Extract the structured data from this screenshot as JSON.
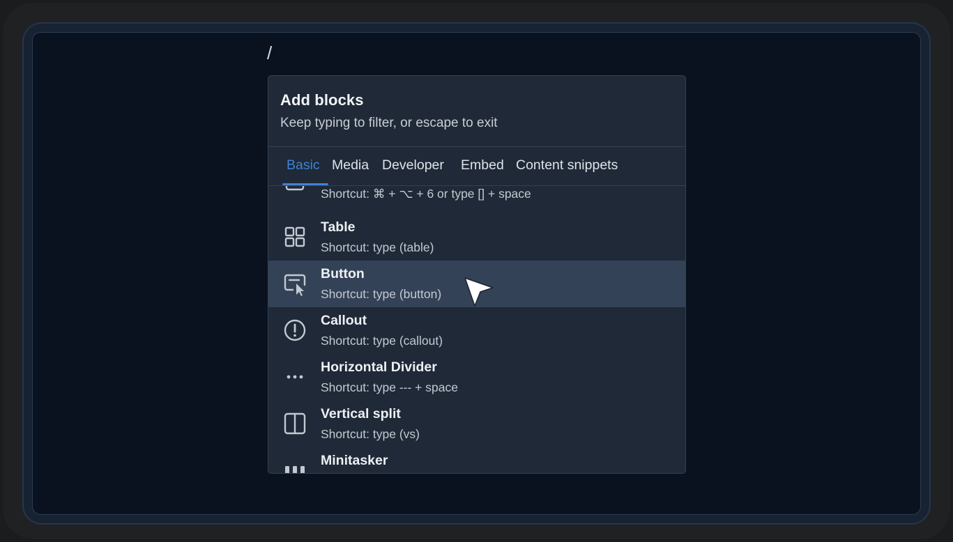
{
  "editor": {
    "typed_text": "/"
  },
  "popup": {
    "title": "Add blocks",
    "subtitle": "Keep typing to filter, or escape to exit"
  },
  "tabs": [
    {
      "label": "Basic",
      "active": true
    },
    {
      "label": "Media"
    },
    {
      "label": "Developer"
    },
    {
      "label": "Embed"
    },
    {
      "label": "Content snippets"
    }
  ],
  "items": [
    {
      "name": "",
      "shortcut": "Shortcut: ⌘ + ⌥ + 6 or type [] + space",
      "icon": "checkbox-icon"
    },
    {
      "name": "Table",
      "shortcut": "Shortcut: type (table)",
      "icon": "table-grid-icon"
    },
    {
      "name": "Button",
      "shortcut": "Shortcut: type (button)",
      "icon": "button-cursor-icon",
      "highlighted": true
    },
    {
      "name": "Callout",
      "shortcut": "Shortcut: type (callout)",
      "icon": "exclamation-circle-icon"
    },
    {
      "name": "Horizontal Divider",
      "shortcut": "Shortcut: type --- + space",
      "icon": "dots-horizontal-icon"
    },
    {
      "name": "Vertical split",
      "shortcut": "Shortcut: type (vs)",
      "icon": "split-columns-icon"
    },
    {
      "name": "Minitasker",
      "shortcut": "",
      "icon": "minitasker-icon"
    }
  ],
  "colors": {
    "accent": "#3f82d4",
    "popup_bg": "#1f2937",
    "highlight_bg": "#334256",
    "screen_bg": "#0a1220"
  }
}
